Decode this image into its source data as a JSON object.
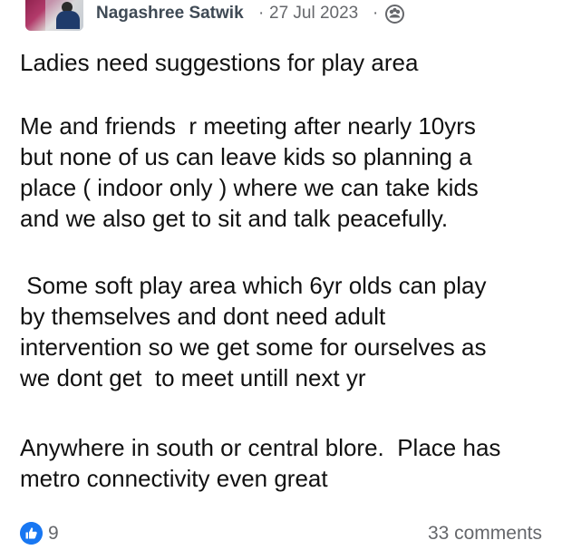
{
  "post": {
    "author": "Nagashree Satwik",
    "separator": "·",
    "date": "27 Jul 2023",
    "audience_icon": "group-icon",
    "paragraphs": [
      "Ladies need suggestions for play area",
      "Me and friends  r meeting after nearly 10yrs\nbut none of us can leave kids so planning a\nplace ( indoor only ) where we can take kids\nand we also get to sit and talk peacefully.",
      " Some soft play area which 6yr olds can play\nby themselves and dont need adult\nintervention so we get some for ourselves as\nwe dont get  to meet untill next yr",
      "Anywhere in south or central blore.  Place has\nmetro connectivity even great"
    ]
  },
  "footer": {
    "reaction_icon": "like-icon",
    "reaction_count": "9",
    "comments": "33 comments"
  },
  "colors": {
    "like_blue": "#1877f2",
    "meta_gray": "#65676b",
    "text": "#111111",
    "author": "#3f4a55"
  }
}
